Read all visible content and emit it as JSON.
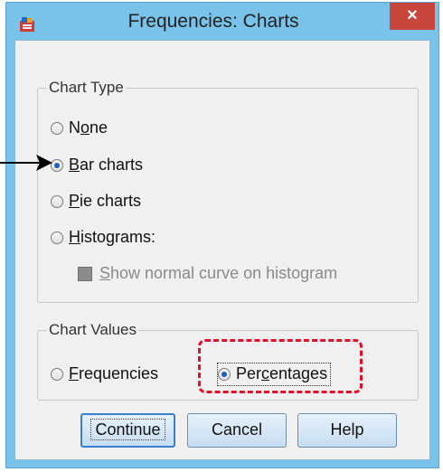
{
  "window": {
    "title": "Frequencies: Charts",
    "close_glyph": "×"
  },
  "chart_type": {
    "legend": "Chart Type",
    "options": [
      {
        "pre": "N",
        "u": "o",
        "post": "ne",
        "selected": false
      },
      {
        "pre": "",
        "u": "B",
        "post": "ar charts",
        "selected": true
      },
      {
        "pre": "",
        "u": "P",
        "post": "ie charts",
        "selected": false
      },
      {
        "pre": "",
        "u": "H",
        "post": "istograms:",
        "selected": false
      }
    ],
    "show_normal_curve": {
      "u": "S",
      "post": "how normal curve on histogram",
      "checked": true,
      "enabled": false
    }
  },
  "chart_values": {
    "legend": "Chart Values",
    "frequencies": {
      "u": "F",
      "post": "requencies",
      "selected": false
    },
    "percentages": {
      "pre": "Per",
      "u": "c",
      "post": "entages",
      "selected": true
    }
  },
  "buttons": {
    "continue": "Continue",
    "cancel": "Cancel",
    "help": "Help"
  },
  "annotations": {
    "arrow_color": "#000000",
    "highlight_color": "#e0102a"
  }
}
